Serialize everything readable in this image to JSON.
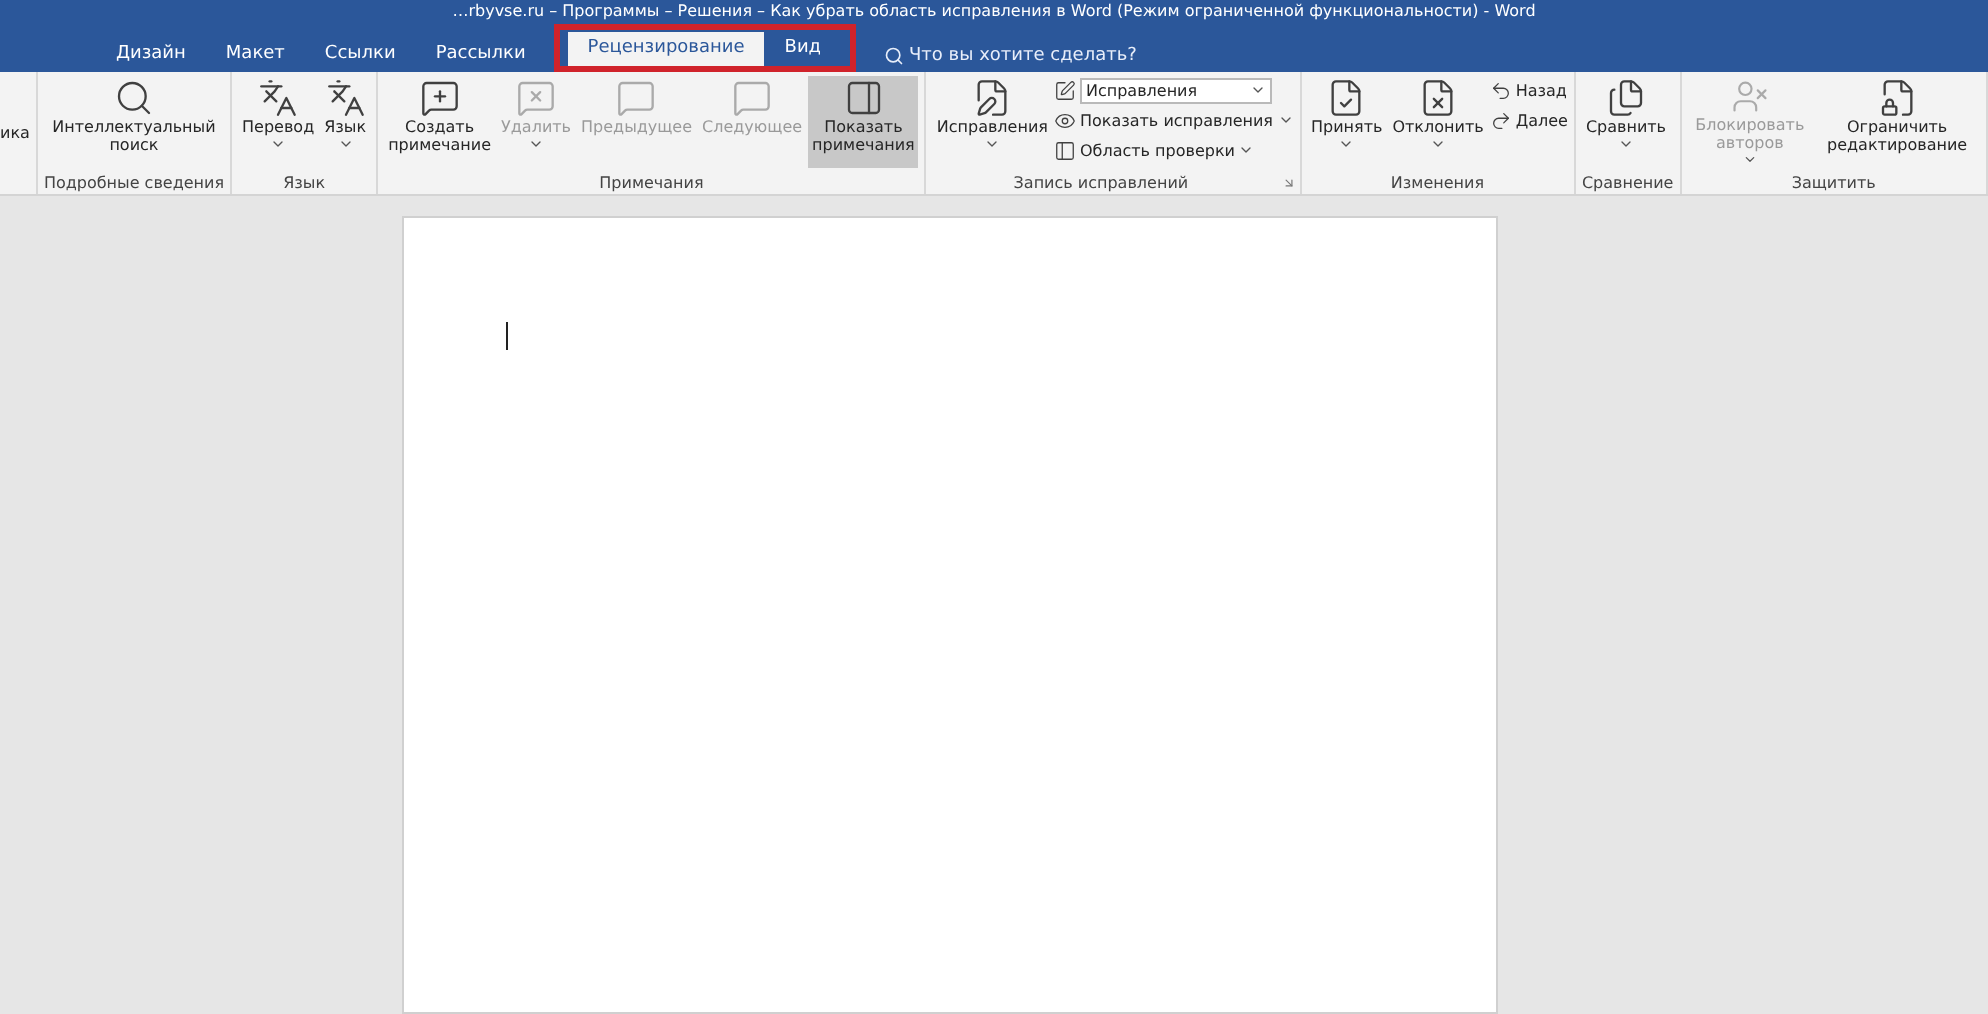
{
  "window": {
    "title": "…rbyvse.ru – Программы – Решения – Как убрать область исправления в Word (Режим ограниченной функциональности) - Word"
  },
  "tabs": [
    {
      "label": "Дизайн",
      "selected": false
    },
    {
      "label": "Макет",
      "selected": false
    },
    {
      "label": "Ссылки",
      "selected": false
    },
    {
      "label": "Рассылки",
      "selected": false
    },
    {
      "label": "Рецензирование",
      "selected": true
    },
    {
      "label": "Вид",
      "selected": false
    }
  ],
  "tell_me": {
    "placeholder": "Что вы хотите сделать?"
  },
  "ribbon_groups": [
    {
      "items": [
        {
          "kind": "cut",
          "label": "ика"
        }
      ]
    },
    {
      "label": "Подробные сведения",
      "items": [
        {
          "kind": "large",
          "label": "Интеллектуальный поиск",
          "disabled": false,
          "selected": false,
          "dropdown": false
        }
      ]
    },
    {
      "label": "Язык",
      "items": [
        {
          "kind": "large",
          "label": "Перевод",
          "disabled": false,
          "selected": false,
          "dropdown": true
        },
        {
          "kind": "large",
          "label": "Язык",
          "disabled": false,
          "selected": false,
          "dropdown": true
        }
      ]
    },
    {
      "label": "Примечания",
      "items": [
        {
          "kind": "large",
          "label": "Создать примечание",
          "disabled": false,
          "selected": false,
          "dropdown": false
        },
        {
          "kind": "large",
          "label": "Удалить",
          "disabled": true,
          "selected": false,
          "dropdown": true
        },
        {
          "kind": "large",
          "label": "Предыдущее",
          "disabled": true,
          "selected": false,
          "dropdown": false
        },
        {
          "kind": "large",
          "label": "Следующее",
          "disabled": true,
          "selected": false,
          "dropdown": false
        },
        {
          "kind": "large",
          "label": "Показать примечания",
          "disabled": false,
          "selected": true,
          "dropdown": false
        }
      ]
    },
    {
      "label": "Запись исправлений",
      "launcher": true,
      "items": [
        {
          "kind": "large",
          "label": "Исправления",
          "disabled": false,
          "selected": false,
          "dropdown": true
        },
        {
          "kind": "stack",
          "items": [
            {
              "kind": "select",
              "label": "Исправления"
            },
            {
              "kind": "small",
              "label": "Показать исправления",
              "dropdown": true
            },
            {
              "kind": "small",
              "label": "Область проверки",
              "dropdown": true
            }
          ]
        }
      ]
    },
    {
      "label": "Изменения",
      "items": [
        {
          "kind": "large",
          "label": "Принять",
          "disabled": false,
          "selected": false,
          "dropdown": true
        },
        {
          "kind": "large",
          "label": "Отклонить",
          "disabled": false,
          "selected": false,
          "dropdown": true
        },
        {
          "kind": "stack",
          "items": [
            {
              "kind": "small",
              "label": "Назад",
              "dropdown": false
            },
            {
              "kind": "small",
              "label": "Далее",
              "dropdown": false
            }
          ]
        }
      ]
    },
    {
      "label": "Сравнение",
      "items": [
        {
          "kind": "large",
          "label": "Сравнить",
          "disabled": false,
          "selected": false,
          "dropdown": true
        }
      ]
    },
    {
      "label": "Защитить",
      "items": [
        {
          "kind": "large",
          "label": "Блокировать авторов",
          "disabled": true,
          "selected": false,
          "dropdown": true
        },
        {
          "kind": "large",
          "label": "Ограничить редактирование",
          "disabled": false,
          "selected": false,
          "dropdown": false
        }
      ]
    }
  ]
}
